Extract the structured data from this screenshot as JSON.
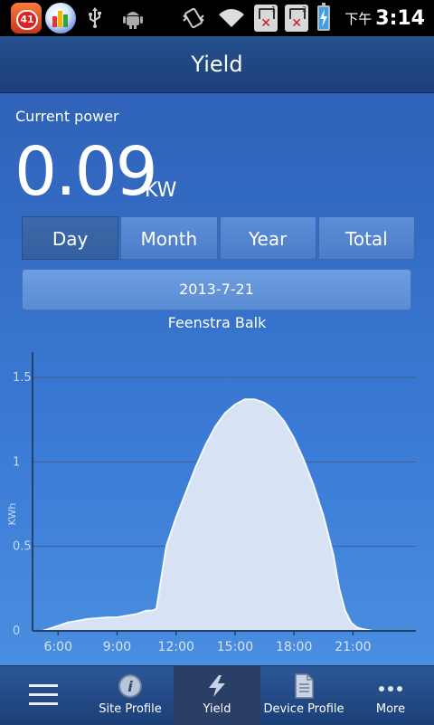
{
  "status_bar": {
    "notification_badge": "41",
    "sim1_number": "1",
    "sim2_number": "2",
    "ampm": "下午",
    "time": "3:14"
  },
  "title": "Yield",
  "current_power": {
    "label": "Current power",
    "value": "0.09",
    "unit": "KW"
  },
  "period_tabs": [
    {
      "label": "Day",
      "active": true
    },
    {
      "label": "Month",
      "active": false
    },
    {
      "label": "Year",
      "active": false
    },
    {
      "label": "Total",
      "active": false
    }
  ],
  "selected_date": "2013-7-21",
  "site_name": "Feenstra Balk",
  "chart_data": {
    "type": "area",
    "ylabel": "KWh",
    "xlabel": "",
    "ylim": [
      0,
      1.5
    ],
    "xlim_hours": [
      4.7,
      24.2
    ],
    "y_ticks": [
      "0",
      "0.5",
      "1",
      "1.5"
    ],
    "x_ticks": [
      {
        "label": "6:00",
        "hour": 6
      },
      {
        "label": "9:00",
        "hour": 9
      },
      {
        "label": "12:00",
        "hour": 12
      },
      {
        "label": "15:00",
        "hour": 15
      },
      {
        "label": "18:00",
        "hour": 18
      },
      {
        "label": "21:00",
        "hour": 21
      }
    ],
    "grid": true,
    "series": [
      {
        "x": [
          5.2,
          5.5,
          6.0,
          6.5,
          7.0,
          7.5,
          8.0,
          8.5,
          9.0,
          9.5,
          10.0,
          10.5,
          10.8,
          11.0,
          11.5,
          12.0,
          12.5,
          13.0,
          13.5,
          14.0,
          14.5,
          15.0,
          15.5,
          16.0,
          16.5,
          17.0,
          17.5,
          18.0,
          18.5,
          19.0,
          19.5,
          20.0,
          20.3,
          20.6,
          20.9,
          21.2,
          21.5,
          22.0,
          22.5,
          23.0,
          23.5
        ],
        "y": [
          0.0,
          0.01,
          0.03,
          0.05,
          0.06,
          0.07,
          0.075,
          0.08,
          0.08,
          0.09,
          0.1,
          0.12,
          0.12,
          0.13,
          0.5,
          0.67,
          0.82,
          0.97,
          1.1,
          1.21,
          1.29,
          1.34,
          1.37,
          1.37,
          1.35,
          1.31,
          1.24,
          1.14,
          1.01,
          0.86,
          0.68,
          0.45,
          0.25,
          0.12,
          0.05,
          0.02,
          0.01,
          0.0,
          0.0,
          0.0,
          0.0
        ]
      }
    ]
  },
  "bottom_nav": [
    {
      "label": "",
      "icon": "menu-icon",
      "active": false
    },
    {
      "label": "Site Profile",
      "icon": "info-icon",
      "active": false
    },
    {
      "label": "Yield",
      "icon": "lightning-icon",
      "active": true
    },
    {
      "label": "Device Profile",
      "icon": "document-icon",
      "active": false
    },
    {
      "label": "More",
      "icon": "more-dots-icon",
      "active": false
    }
  ],
  "colors": {
    "title_bar": "#1b3f78",
    "chart_fill": "#dfe8f6",
    "chart_grid": "#3e5f90",
    "active_nav": "#2a3f66"
  }
}
